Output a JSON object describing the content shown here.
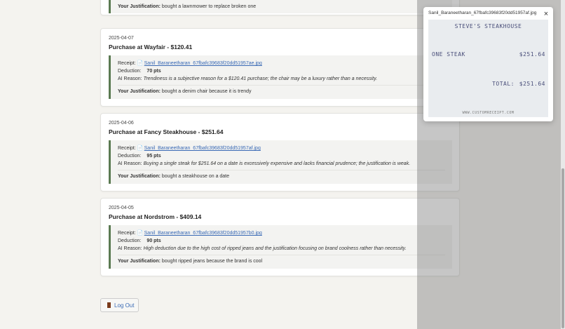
{
  "purchases": [
    {
      "justification_label": "Your Justification:",
      "justification": "bought a lawnmower to replace broken one"
    },
    {
      "date": "2025-04-07",
      "title": "Purchase at Wayfair - $120.41",
      "receipt_label": "Receipt:",
      "receipt_file": "Sanil_Baraneetharan_67fbafc39683f20dd51957ae.jpg",
      "deduction_label": "Deduction:",
      "deduction": "70 pts",
      "ai_label": "AI Reason:",
      "ai_reason": "Trendiness is a subjective reason for a $120.41 purchase; the chair may be a luxury rather than a necessity.",
      "justification_label": "Your Justification:",
      "justification": "bought a denim chair because it is trendy"
    },
    {
      "date": "2025-04-06",
      "title": "Purchase at Fancy Steakhouse - $251.64",
      "receipt_label": "Receipt:",
      "receipt_file": "Sanil_Baraneetharan_67fbafc39683f20dd51957af.jpg",
      "deduction_label": "Deduction:",
      "deduction": "95 pts",
      "ai_label": "AI Reason:",
      "ai_reason": "Buying a single steak for $251.64 on a date is excessively expensive and lacks financial prudence; the justification is weak.",
      "justification_label": "Your Justification:",
      "justification": "bought a steakhouse on a date"
    },
    {
      "date": "2025-04-05",
      "title": "Purchase at Nordstrom - $409.14",
      "receipt_label": "Receipt:",
      "receipt_file": "Sanil_Baraneetharan_67fbafc39683f20dd51957b0.jpg",
      "deduction_label": "Deduction:",
      "deduction": "90 pts",
      "ai_label": "AI Reason:",
      "ai_reason": "High deduction due to the high cost of ripped jeans and the justification focusing on brand coolness rather than necessity.",
      "justification_label": "Your Justification:",
      "justification": "bought ripped jeans because the brand is cool"
    }
  ],
  "logout_label": "Log Out",
  "popup": {
    "filename": "Sanil_Baraneetharan_67fbafc39683f20dd51957af.jpg",
    "close": "×",
    "receipt": {
      "store": "STEVE'S STEAKHOUSE",
      "item": "ONE STEAK",
      "item_price": "$251.64",
      "total_label": "TOTAL:",
      "total": "$251.64",
      "footer": "WWW.CUSTOMRECEIPT.COM"
    }
  }
}
